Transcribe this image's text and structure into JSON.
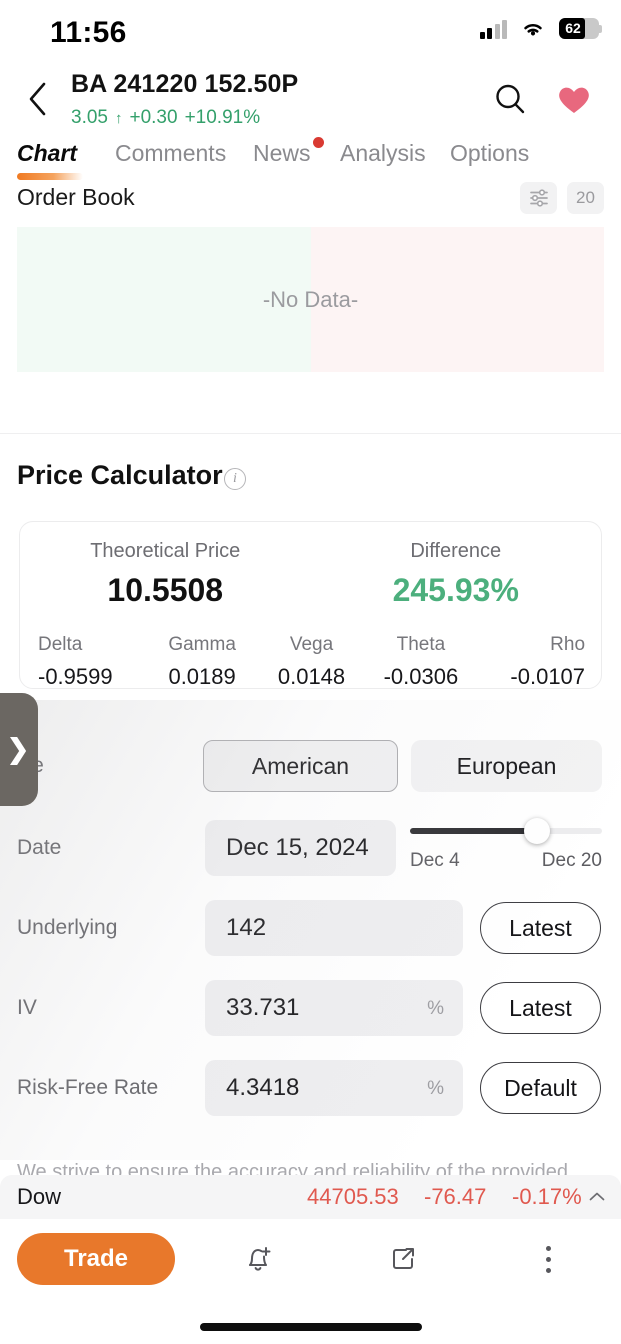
{
  "status_bar": {
    "time": "11:56",
    "battery_level": "62",
    "signal_icon": "cellular-signal-icon",
    "wifi_icon": "wifi-icon",
    "battery_icon": "battery-icon"
  },
  "header": {
    "back_icon": "chevron-left-icon",
    "title": "BA 241220 152.50P",
    "price": "3.05",
    "direction_arrow": "↑",
    "change": "+0.30",
    "change_percent": "+10.91%",
    "change_color": "#34a06b",
    "search_icon": "search-icon",
    "favorite_icon": "heart-icon",
    "favorite_color": "#e8687e"
  },
  "tabs": [
    {
      "label": "Chart",
      "active": true,
      "badge": false
    },
    {
      "label": "Comments",
      "active": false,
      "badge": false
    },
    {
      "label": "News",
      "active": false,
      "badge": true
    },
    {
      "label": "Analysis",
      "active": false,
      "badge": false
    },
    {
      "label": "Options",
      "active": false,
      "badge": false
    }
  ],
  "order_book": {
    "title": "Order Book",
    "settings_icon": "sliders-icon",
    "depth_label": "20",
    "empty_text": "-No Data-",
    "bid_color": "#f2faf5",
    "ask_color": "#fdf4f4"
  },
  "price_calculator": {
    "title": "Price Calculator",
    "info_icon": "info-icon",
    "theoretical_price_label": "Theoretical Price",
    "theoretical_price_value": "10.5508",
    "difference_label": "Difference",
    "difference_value": "245.93%",
    "difference_color": "#4caf7d",
    "greeks": [
      {
        "label": "Delta",
        "value": "-0.9599"
      },
      {
        "label": "Gamma",
        "value": "0.0189"
      },
      {
        "label": "Vega",
        "value": "0.0148"
      },
      {
        "label": "Theta",
        "value": "-0.0306"
      },
      {
        "label": "Rho",
        "value": "-0.0107"
      }
    ]
  },
  "form": {
    "style_label": "yle",
    "style_options": [
      {
        "label": "American",
        "selected": true
      },
      {
        "label": "European",
        "selected": false
      }
    ],
    "date_label": "Date",
    "date_value": "Dec 15, 2024",
    "date_slider_min": "Dec 4",
    "date_slider_max": "Dec 20",
    "underlying_label": "Underlying",
    "underlying_value": "142",
    "underlying_action": "Latest",
    "iv_label": "IV",
    "iv_value": "33.731",
    "iv_unit": "%",
    "iv_action": "Latest",
    "rate_label": "Risk-Free Rate",
    "rate_value": "4.3418",
    "rate_unit": "%",
    "rate_action": "Default",
    "drawer_icon": "chevron-right-icon"
  },
  "disclaimer": "We strive to ensure the accuracy and reliability of the provided",
  "ticker": {
    "name": "Dow",
    "value": "44705.53",
    "change": "-76.47",
    "change_percent": "-0.17%",
    "color": "#e0594f",
    "collapse_icon": "chevron-up-icon"
  },
  "bottom_bar": {
    "trade_label": "Trade",
    "trade_color": "#e8782b",
    "alert_icon": "bell-plus-icon",
    "share_icon": "share-icon",
    "more_icon": "more-vertical-icon"
  }
}
